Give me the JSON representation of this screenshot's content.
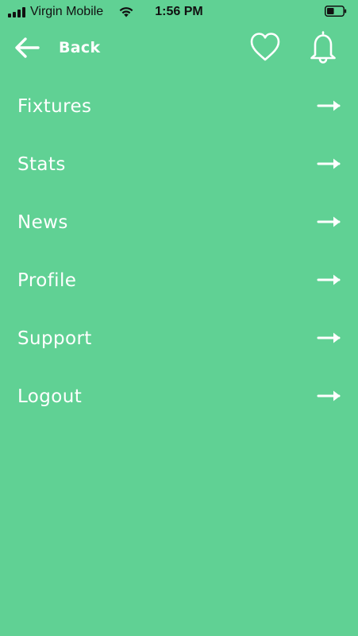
{
  "status_bar": {
    "carrier": "Virgin Mobile",
    "time": "1:56 PM",
    "signal_icon": "cellular-signal-icon",
    "wifi_icon": "wifi-icon",
    "battery_icon": "battery-icon",
    "battery_level": 0.45
  },
  "header": {
    "back_label": "Back",
    "back_icon": "arrow-left-icon",
    "favorite_icon": "heart-icon",
    "notifications_icon": "bell-icon"
  },
  "menu": {
    "items": [
      {
        "label": "Fixtures",
        "icon": "arrow-right-icon"
      },
      {
        "label": "Stats",
        "icon": "arrow-right-icon"
      },
      {
        "label": "News",
        "icon": "arrow-right-icon"
      },
      {
        "label": "Profile",
        "icon": "arrow-right-icon"
      },
      {
        "label": "Support",
        "icon": "arrow-right-icon"
      },
      {
        "label": "Logout",
        "icon": "arrow-right-icon"
      }
    ]
  },
  "colors": {
    "background": "#60d194",
    "foreground": "#ffffff",
    "status_text": "#111111"
  }
}
